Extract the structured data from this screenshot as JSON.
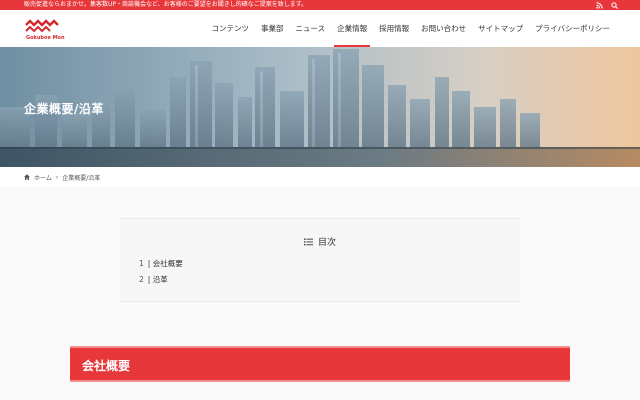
{
  "topbar": {
    "message": "販売促進ならおまかせ。集客数UP・商談機会など、お客様のご要望をお聞きし的確なご提案を致します。",
    "icons": [
      "rss-icon",
      "search-icon"
    ]
  },
  "logo": {
    "brand_text": "Gokuboe Mon"
  },
  "nav": {
    "items": [
      {
        "label": "コンテンツ"
      },
      {
        "label": "事業部"
      },
      {
        "label": "ニュース"
      },
      {
        "label": "企業情報"
      },
      {
        "label": "採用情報"
      },
      {
        "label": "お問い合わせ"
      },
      {
        "label": "サイトマップ"
      },
      {
        "label": "プライバシーポリシー"
      }
    ],
    "active_label": "企業情報"
  },
  "hero": {
    "title": "企業概要/沿革"
  },
  "breadcrumb": {
    "home": "ホーム",
    "separator": "›",
    "current": "企業概要/沿革"
  },
  "toc": {
    "title": "目次",
    "items": [
      {
        "num": "1",
        "label": "会社概要"
      },
      {
        "num": "2",
        "label": "沿革"
      }
    ]
  },
  "section": {
    "title": "会社概要"
  },
  "colors": {
    "accent": "#e8373a"
  }
}
